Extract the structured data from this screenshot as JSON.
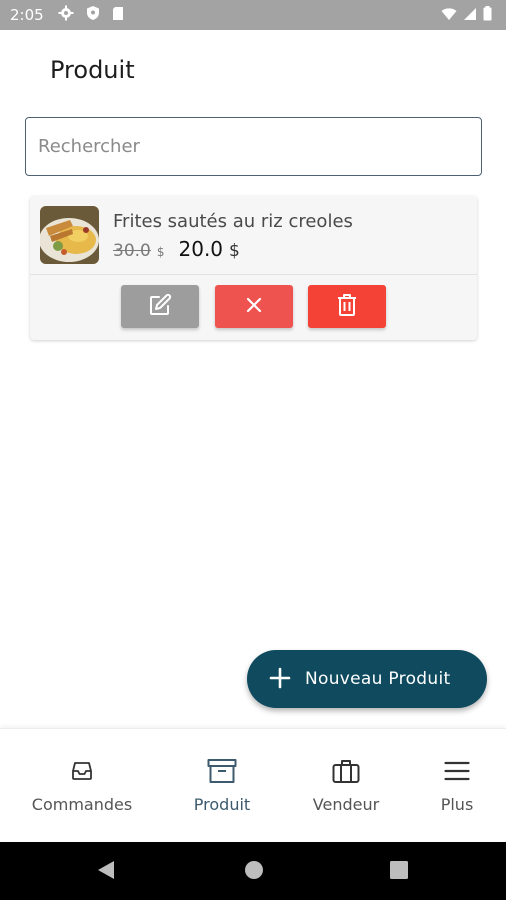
{
  "status_bar": {
    "time": "2:05",
    "icons": [
      "gear-icon",
      "shield-icon",
      "sd-card-icon",
      "wifi-icon",
      "signal-icon",
      "battery-icon"
    ]
  },
  "header": {
    "title": "Produit"
  },
  "search": {
    "placeholder": "Rechercher",
    "value": ""
  },
  "products": [
    {
      "name": "Frites sautés au riz creoles",
      "old_price": "30.0",
      "old_currency": "$",
      "new_price": "20.0",
      "new_currency": "$",
      "actions": [
        "edit-icon",
        "close-icon",
        "trash-icon"
      ]
    }
  ],
  "fab": {
    "label": "Nouveau Produit",
    "icon": "plus-icon",
    "color": "#0f4a5f"
  },
  "bottom_nav": {
    "active": "Produit",
    "items": [
      {
        "label": "Commandes",
        "icon": "inbox-icon"
      },
      {
        "label": "Produit",
        "icon": "archive-box-icon"
      },
      {
        "label": "Vendeur",
        "icon": "briefcase-icon"
      },
      {
        "label": "Plus",
        "icon": "menu-icon"
      }
    ]
  },
  "colors": {
    "edit_button": "#9d9d9d",
    "cancel_button": "#ef5350",
    "delete_button": "#f44336",
    "active_nav": "#3d5a6e"
  }
}
